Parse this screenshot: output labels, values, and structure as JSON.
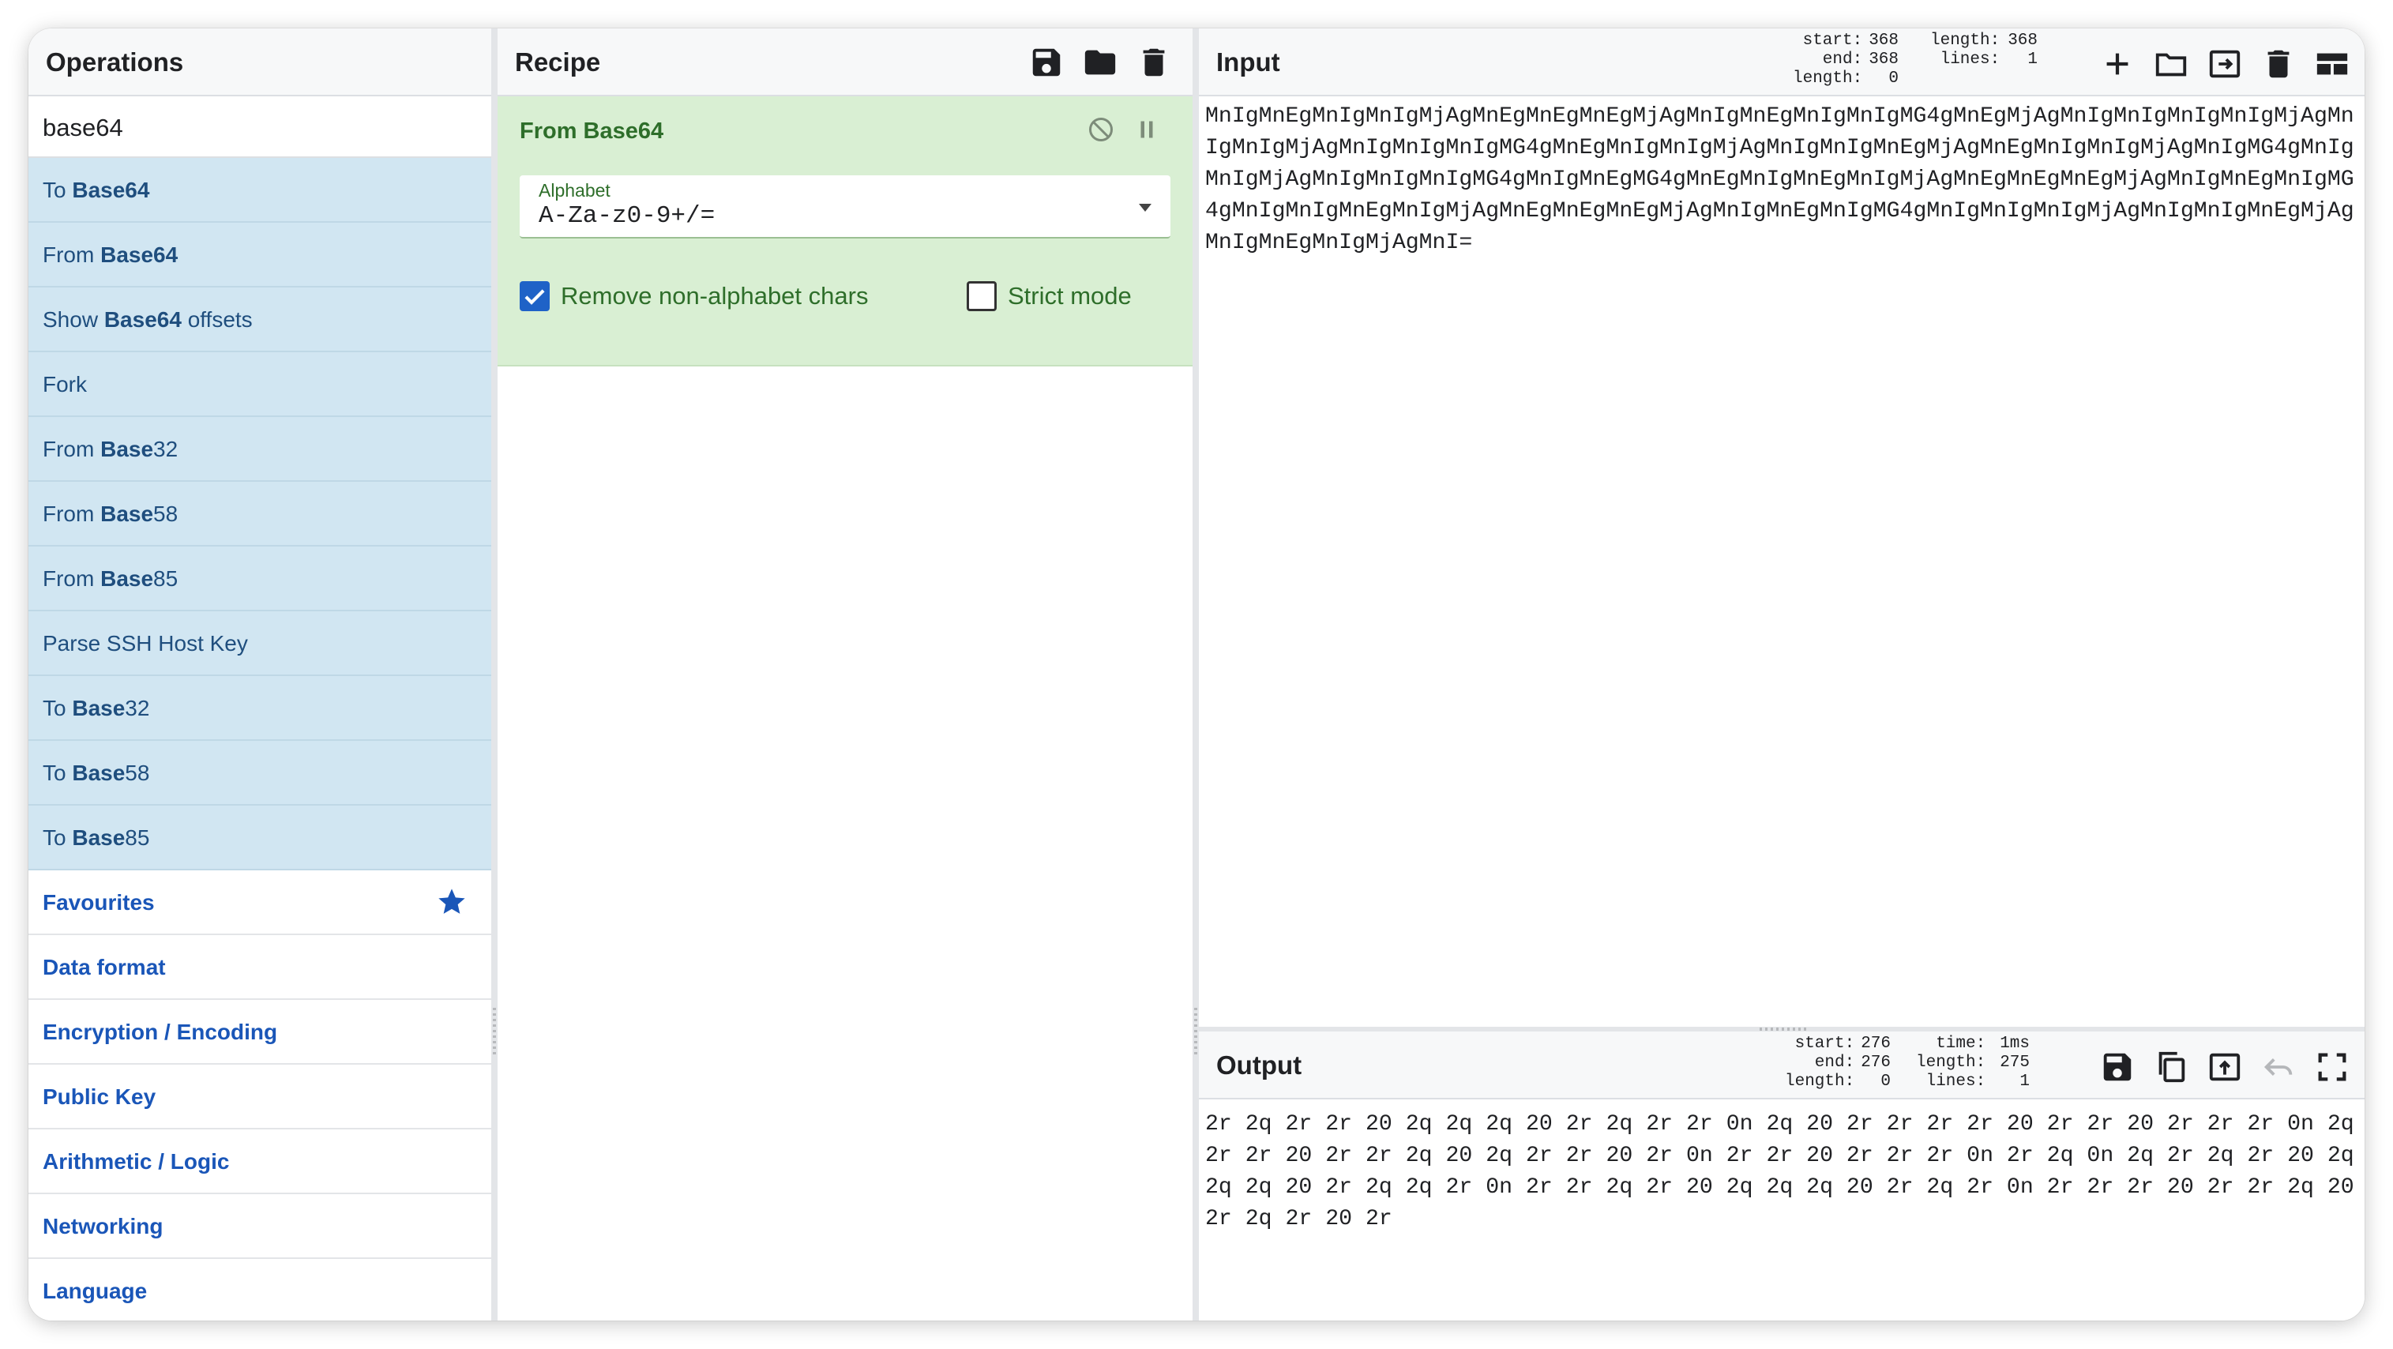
{
  "operations": {
    "title": "Operations",
    "search_value": "base64",
    "results": [
      {
        "pre": "To ",
        "bold": "Base64",
        "post": ""
      },
      {
        "pre": "From ",
        "bold": "Base64",
        "post": ""
      },
      {
        "pre": "Show ",
        "bold": "Base64",
        "post": " offsets"
      },
      {
        "pre": "Fork",
        "bold": "",
        "post": ""
      },
      {
        "pre": "From ",
        "bold": "Base",
        "post": "32"
      },
      {
        "pre": "From ",
        "bold": "Base",
        "post": "58"
      },
      {
        "pre": "From ",
        "bold": "Base",
        "post": "85"
      },
      {
        "pre": "Parse SSH Host Key",
        "bold": "",
        "post": ""
      },
      {
        "pre": "To ",
        "bold": "Base",
        "post": "32"
      },
      {
        "pre": "To ",
        "bold": "Base",
        "post": "58"
      },
      {
        "pre": "To ",
        "bold": "Base",
        "post": "85"
      }
    ],
    "categories": [
      "Favourites",
      "Data format",
      "Encryption / Encoding",
      "Public Key",
      "Arithmetic / Logic",
      "Networking",
      "Language"
    ]
  },
  "recipe": {
    "title": "Recipe",
    "operation": {
      "name": "From Base64",
      "alphabet_label": "Alphabet",
      "alphabet_value": "A-Za-z0-9+/=",
      "remove_label": "Remove non-alphabet chars",
      "remove_checked": true,
      "strict_label": "Strict mode",
      "strict_checked": false
    }
  },
  "input": {
    "title": "Input",
    "stats_sel_labels": "start:\n  end:\nlength:",
    "stats_sel_values": "368\n368\n0",
    "stats_len_labels": "length:\n lines:",
    "stats_len_values": "368\n1",
    "text": "MnIgMnEgMnIgMnIgMjAgMnEgMnEgMnEgMjAgMnIgMnEgMnIgMnIgMG4gMnEgMjAgMnIgMnIgMnIgMnIgMjAgMnIgMnIgMjAgMnIgMnIgMnIgMG4gMnEgMnIgMnIgMjAgMnIgMnIgMnEgMjAgMnEgMnIgMnIgMjAgMnIgMG4gMnIgMnIgMjAgMnIgMnIgMnIgMG4gMnIgMnEgMG4gMnEgMnIgMnEgMnIgMjAgMnEgMnEgMnEgMjAgMnIgMnEgMnIgMG4gMnIgMnIgMnEgMnIgMjAgMnEgMnEgMnEgMjAgMnIgMnEgMnIgMG4gMnIgMnIgMnIgMjAgMnIgMnIgMnEgMjAgMnIgMnEgMnIgMjAgMnI="
  },
  "output": {
    "title": "Output",
    "stats_sel_labels": "start:\n  end:\nlength:",
    "stats_sel_values": "276\n276\n0",
    "stats_info_labels": "  time:\nlength:\n lines:",
    "stats_info_values": "1ms\n275\n1",
    "text": "2r 2q 2r 2r 20 2q 2q 2q 20 2r 2q 2r 2r 0n 2q 20 2r 2r 2r 2r 20 2r 2r 20 2r 2r 2r 0n 2q 2r 2r 20 2r 2r 2q 20 2q 2r 2r 20 2r 0n 2r 2r 20 2r 2r 2r 0n 2r 2q 0n 2q 2r 2q 2r 20 2q 2q 2q 20 2r 2q 2q 2r 0n 2r 2r 2q 2r 20 2q 2q 2q 20 2r 2q 2r 0n 2r 2r 2r 20 2r 2r 2q 20 2r 2q 2r 20 2r"
  },
  "colors": {
    "accent_blue": "#1a56b8",
    "recipe_green": "#d9efd3",
    "op_highlight": "#d1e6f2"
  }
}
